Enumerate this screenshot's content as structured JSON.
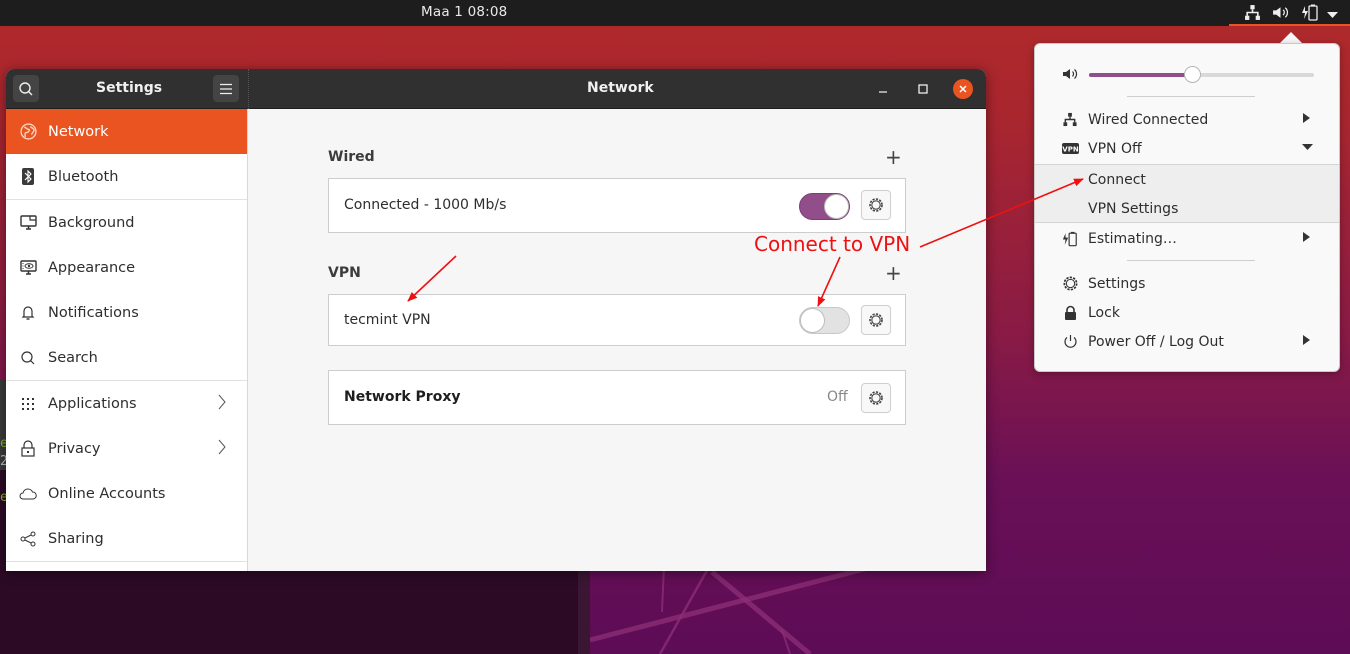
{
  "topbar": {
    "clock": "Maa 1  08:08",
    "tray_icons": [
      "network-wired-icon",
      "volume-icon",
      "battery-charging-icon",
      "dropdown-arrow-icon"
    ]
  },
  "window": {
    "sidebar_title": "Settings",
    "main_title": "Network",
    "controls": {
      "minimize": "minimize",
      "maximize": "maximize",
      "close": "close"
    }
  },
  "sidebar": {
    "items": [
      {
        "label": "Network",
        "icon": "globe-icon",
        "active": true,
        "chevron": false
      },
      {
        "label": "Bluetooth",
        "icon": "bluetooth-icon",
        "active": false,
        "chevron": false
      },
      {
        "label": "Background",
        "icon": "monitor-icon",
        "active": false,
        "chevron": false
      },
      {
        "label": "Appearance",
        "icon": "appearance-icon",
        "active": false,
        "chevron": false
      },
      {
        "label": "Notifications",
        "icon": "bell-icon",
        "active": false,
        "chevron": false
      },
      {
        "label": "Search",
        "icon": "search-icon",
        "active": false,
        "chevron": false
      },
      {
        "label": "Applications",
        "icon": "grid-icon",
        "active": false,
        "chevron": true
      },
      {
        "label": "Privacy",
        "icon": "lock-icon",
        "active": false,
        "chevron": true
      },
      {
        "label": "Online Accounts",
        "icon": "cloud-icon",
        "active": false,
        "chevron": false
      },
      {
        "label": "Sharing",
        "icon": "share-icon",
        "active": false,
        "chevron": false
      }
    ]
  },
  "network": {
    "wired": {
      "title": "Wired",
      "add_label": "+",
      "connection_label": "Connected - 1000 Mb/s",
      "enabled": true
    },
    "vpn": {
      "title": "VPN",
      "add_label": "+",
      "connection_label": "tecmint VPN",
      "enabled": false
    },
    "proxy": {
      "label": "Network Proxy",
      "value": "Off"
    }
  },
  "annotation": {
    "text": "Connect to VPN",
    "color": "#ee1111"
  },
  "system_menu": {
    "volume_percent": 46,
    "wired": {
      "label": "Wired Connected"
    },
    "vpn": {
      "label": "VPN Off",
      "icon_text": "VPN"
    },
    "vpn_submenu": [
      {
        "label": "Connect"
      },
      {
        "label": "VPN Settings"
      }
    ],
    "battery": {
      "label": "Estimating…"
    },
    "settings": {
      "label": "Settings"
    },
    "lock": {
      "label": "Lock"
    },
    "power": {
      "label": "Power Off / Log Out"
    }
  },
  "colors": {
    "accent": "#e95420",
    "switch_on": "#924d8b",
    "headerbar": "#303030",
    "topbar": "#1d1d1d"
  }
}
